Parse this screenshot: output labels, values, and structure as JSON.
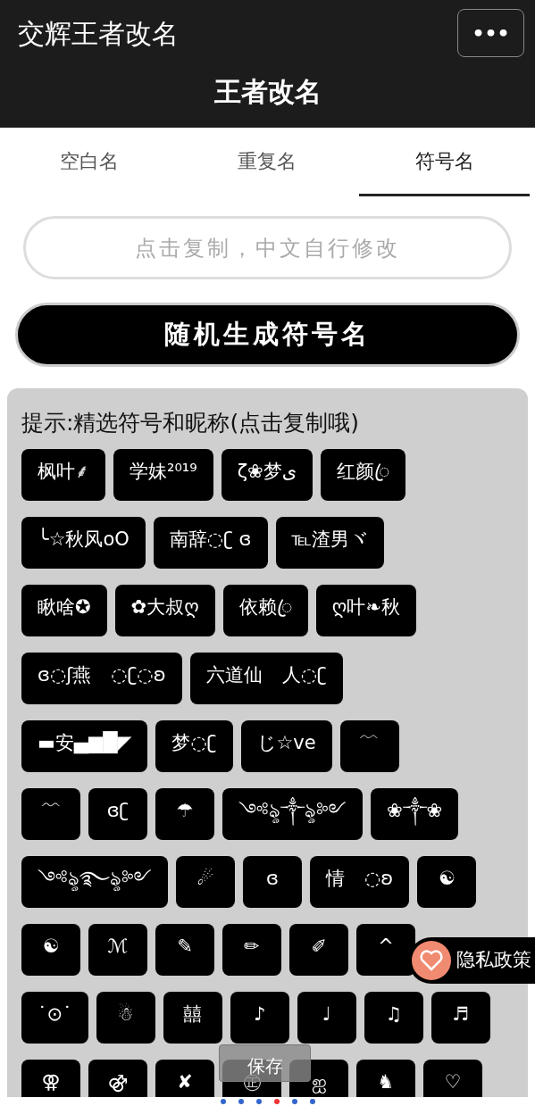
{
  "header": {
    "app_name": "交辉王者改名",
    "more_button": "•••",
    "title": "王者改名"
  },
  "tabs": [
    {
      "label": "空白名",
      "selected": false
    },
    {
      "label": "重复名",
      "selected": false
    },
    {
      "label": "符号名",
      "selected": true
    }
  ],
  "copy_field": {
    "placeholder": "点击复制，中文自行修改"
  },
  "generate_button": "随机生成符号名",
  "panel": {
    "hint": "提示:精选符号和昵称(点击复制哦)",
    "chip_rows": [
      [
        "枫叶⸙",
        "学妹²⁰¹⁹",
        "ζ❀梦ی",
        "红颜ꦿ"
      ],
      [
        "╰☆秋风oO",
        "南辞◌ʗ ɞ",
        "℡渣男ヾ"
      ],
      [
        "瞅啥✪",
        "✿大叔ღ",
        "依赖ꦿ",
        "ღ叶❧秋"
      ],
      [
        "ɞ◌ʃ燕゙◌ʗ◌ʚ",
        "六道仙゙人◌ʗ"
      ],
      [
        "▬安▄▆█◤",
        "梦◌ʗ",
        "じ☆ve",
        "﹋"
      ],
      [
        "﹌",
        "ɞʗ",
        "☂",
        "༺ৡ༒ৡ༻",
        "❀༒❀"
      ],
      [
        "༺ৡ࿐ৡ༻",
        "☄",
        "ɞ",
        "情゙◌ʚ",
        "☯"
      ],
      [
        "☯",
        "ℳ",
        "✎",
        "✏",
        "✐",
        "^"
      ],
      [
        "˙⊙˙",
        "☃",
        "囍",
        "♪",
        "♩",
        "♫",
        "♬"
      ],
      [
        "⚢",
        "⚣",
        "✘",
        "㊣",
        "ஐ",
        "♞",
        "♡"
      ]
    ]
  },
  "privacy_badge": "隐私政策",
  "save_toast": "保存"
}
